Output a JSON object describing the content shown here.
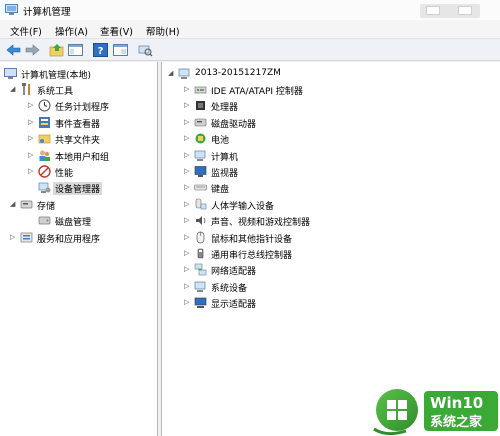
{
  "window": {
    "title": "计算机管理"
  },
  "menu": [
    {
      "label": "文件(F)"
    },
    {
      "label": "操作(A)"
    },
    {
      "label": "查看(V)"
    },
    {
      "label": "帮助(H)"
    }
  ],
  "toolbar": {
    "buttons": [
      {
        "icon": "back-arrow-icon"
      },
      {
        "icon": "forward-arrow-icon"
      },
      {
        "icon": "up-folder-icon"
      },
      {
        "icon": "show-hide-tree-icon"
      },
      {
        "icon": "help-icon"
      },
      {
        "icon": "properties-icon"
      },
      {
        "icon": "scan-hardware-icon"
      }
    ]
  },
  "left_tree": {
    "root": "计算机管理(本地)",
    "system_tools": "系统工具",
    "task_scheduler": "任务计划程序",
    "event_viewer": "事件查看器",
    "shared_folders": "共享文件夹",
    "local_users_groups": "本地用户和组",
    "performance": "性能",
    "device_manager": "设备管理器",
    "storage": "存储",
    "disk_management": "磁盘管理",
    "services_apps": "服务和应用程序"
  },
  "device_tree": {
    "computer_name": "2013-20151217ZM",
    "categories": [
      {
        "label": "IDE ATA/ATAPI 控制器",
        "icon": "ide-controller-icon"
      },
      {
        "label": "处理器",
        "icon": "processor-icon"
      },
      {
        "label": "磁盘驱动器",
        "icon": "disk-drive-icon"
      },
      {
        "label": "电池",
        "icon": "battery-icon"
      },
      {
        "label": "计算机",
        "icon": "computer-icon"
      },
      {
        "label": "监视器",
        "icon": "monitor-icon"
      },
      {
        "label": "键盘",
        "icon": "keyboard-icon"
      },
      {
        "label": "人体学输入设备",
        "icon": "hid-icon"
      },
      {
        "label": "声音、视频和游戏控制器",
        "icon": "sound-icon"
      },
      {
        "label": "鼠标和其他指针设备",
        "icon": "mouse-icon"
      },
      {
        "label": "通用串行总线控制器",
        "icon": "usb-icon"
      },
      {
        "label": "网络适配器",
        "icon": "network-adapter-icon"
      },
      {
        "label": "系统设备",
        "icon": "system-device-icon"
      },
      {
        "label": "显示适配器",
        "icon": "display-adapter-icon"
      }
    ]
  },
  "watermark": {
    "line1": "Win10",
    "line2": "系统之家"
  },
  "colors": {
    "selection": "#d9d9d9",
    "toolbar_bg": "#eef1f5",
    "watermark_green": "#3aa935"
  }
}
